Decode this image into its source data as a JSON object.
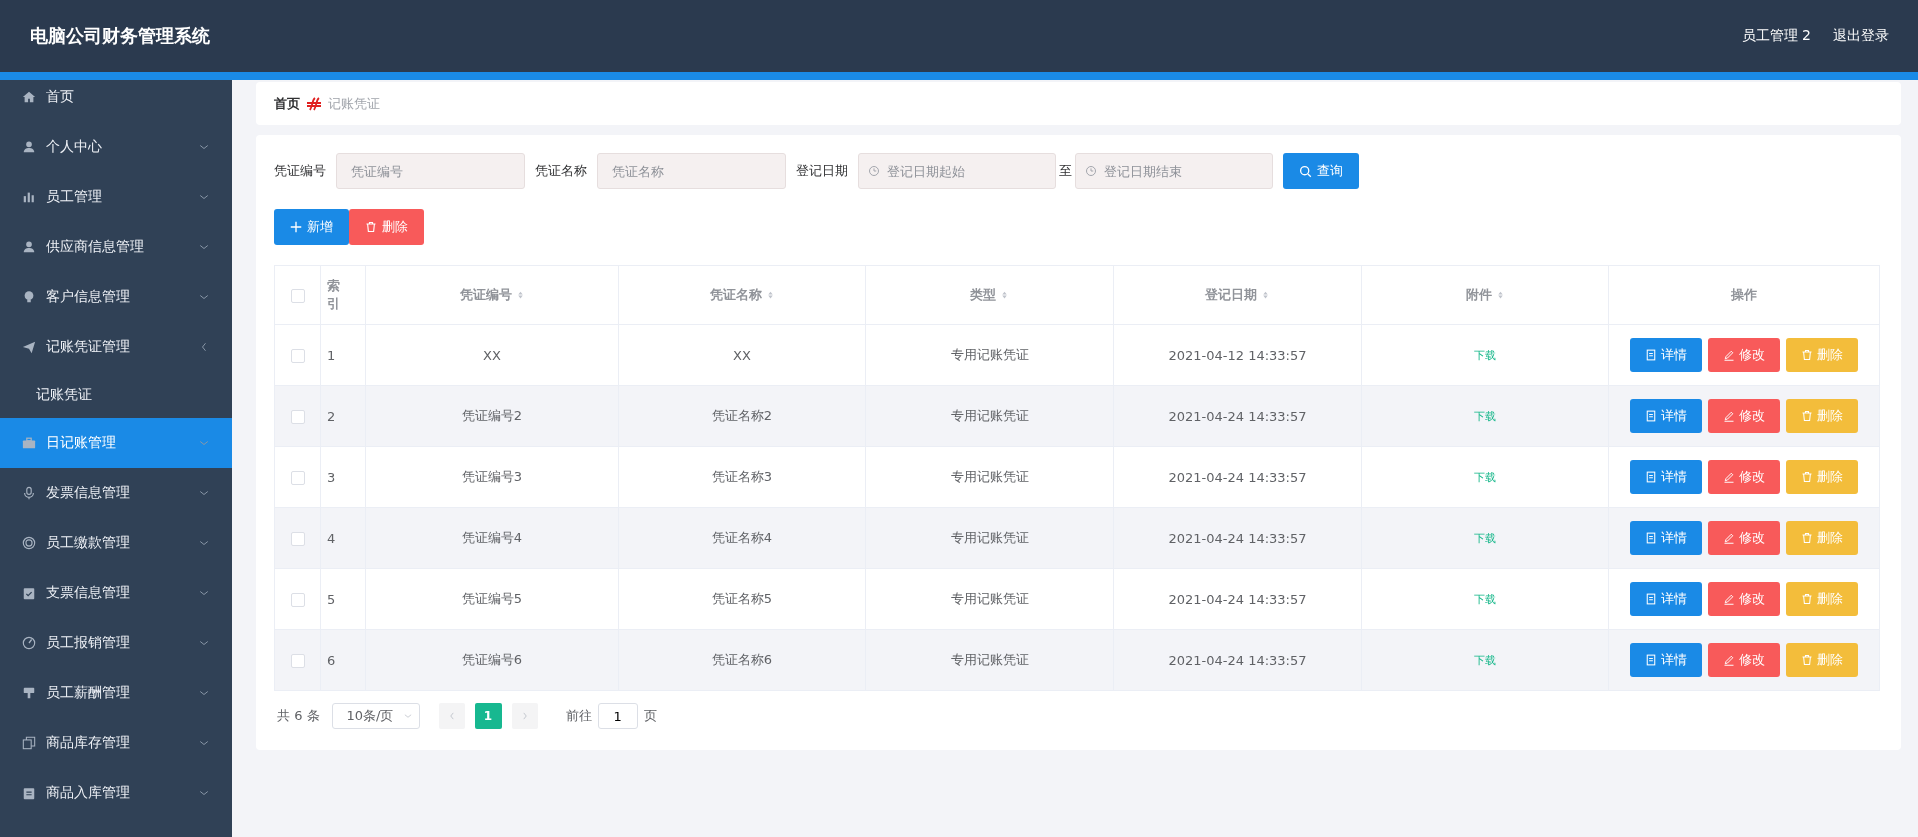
{
  "header": {
    "title": "电脑公司财务管理系统",
    "user": "员工管理 2",
    "logout": "退出登录"
  },
  "sidebar": {
    "items": [
      {
        "label": "首页",
        "kind": "link",
        "selected": false
      },
      {
        "label": "个人中心",
        "kind": "submenu",
        "expanded": false,
        "selected": false
      },
      {
        "label": "员工管理",
        "kind": "submenu",
        "expanded": false,
        "selected": false
      },
      {
        "label": "供应商信息管理",
        "kind": "submenu",
        "expanded": false,
        "selected": false
      },
      {
        "label": "客户信息管理",
        "kind": "submenu",
        "expanded": false,
        "selected": false
      },
      {
        "label": "记账凭证管理",
        "kind": "submenu",
        "expanded": true,
        "selected": false,
        "children": [
          {
            "label": "记账凭证",
            "selected": false
          }
        ]
      },
      {
        "label": "日记账管理",
        "kind": "submenu",
        "expanded": false,
        "selected": true
      },
      {
        "label": "发票信息管理",
        "kind": "submenu",
        "expanded": false,
        "selected": false
      },
      {
        "label": "员工缴款管理",
        "kind": "submenu",
        "expanded": false,
        "selected": false
      },
      {
        "label": "支票信息管理",
        "kind": "submenu",
        "expanded": false,
        "selected": false
      },
      {
        "label": "员工报销管理",
        "kind": "submenu",
        "expanded": false,
        "selected": false
      },
      {
        "label": "员工薪酬管理",
        "kind": "submenu",
        "expanded": false,
        "selected": false
      },
      {
        "label": "商品库存管理",
        "kind": "submenu",
        "expanded": false,
        "selected": false
      },
      {
        "label": "商品入库管理",
        "kind": "submenu",
        "expanded": false,
        "selected": false
      }
    ]
  },
  "breadcrumb": [
    "首页",
    "记账凭证"
  ],
  "search": {
    "fields": [
      {
        "label": "凭证编号",
        "placeholder": "凭证编号"
      },
      {
        "label": "凭证名称",
        "placeholder": "凭证名称"
      }
    ],
    "date_range": {
      "label": "登记日期",
      "start_placeholder": "登记日期起始",
      "separator": "至",
      "end_placeholder": "登记日期结束"
    },
    "button": "查询"
  },
  "actions": {
    "add": "新增",
    "delete": "删除"
  },
  "table": {
    "all_checked": false,
    "columns": [
      {
        "label": "索引",
        "sortable": false
      },
      {
        "label": "凭证编号",
        "sortable": true
      },
      {
        "label": "凭证名称",
        "sortable": true
      },
      {
        "label": "类型",
        "sortable": true
      },
      {
        "label": "登记日期",
        "sortable": true
      },
      {
        "label": "附件",
        "sortable": true
      },
      {
        "label": "操作",
        "sortable": false
      }
    ],
    "rows": [
      {
        "checked": false,
        "index": "1",
        "code": "XX",
        "name": "XX",
        "type": "专用记账凭证",
        "date": "2021-04-12 14:33:57",
        "attachment": "下载",
        "actions": [
          "详情",
          "修改",
          "删除"
        ]
      },
      {
        "checked": false,
        "index": "2",
        "code": "凭证编号2",
        "name": "凭证名称2",
        "type": "专用记账凭证",
        "date": "2021-04-24 14:33:57",
        "attachment": "下载",
        "actions": [
          "详情",
          "修改",
          "删除"
        ]
      },
      {
        "checked": false,
        "index": "3",
        "code": "凭证编号3",
        "name": "凭证名称3",
        "type": "专用记账凭证",
        "date": "2021-04-24 14:33:57",
        "attachment": "下载",
        "actions": [
          "详情",
          "修改",
          "删除"
        ]
      },
      {
        "checked": false,
        "index": "4",
        "code": "凭证编号4",
        "name": "凭证名称4",
        "type": "专用记账凭证",
        "date": "2021-04-24 14:33:57",
        "attachment": "下载",
        "actions": [
          "详情",
          "修改",
          "删除"
        ]
      },
      {
        "checked": false,
        "index": "5",
        "code": "凭证编号5",
        "name": "凭证名称5",
        "type": "专用记账凭证",
        "date": "2021-04-24 14:33:57",
        "attachment": "下载",
        "actions": [
          "详情",
          "修改",
          "删除"
        ]
      },
      {
        "checked": false,
        "index": "6",
        "code": "凭证编号6",
        "name": "凭证名称6",
        "type": "专用记账凭证",
        "date": "2021-04-24 14:33:57",
        "attachment": "下载",
        "actions": [
          "详情",
          "修改",
          "删除"
        ]
      }
    ]
  },
  "pagination": {
    "total": "共 6 条",
    "page_size": "10条/页",
    "pages": [
      {
        "label": "1",
        "selected": true
      }
    ],
    "goto": "前往",
    "goto_value": "1",
    "page_unit": "页"
  }
}
